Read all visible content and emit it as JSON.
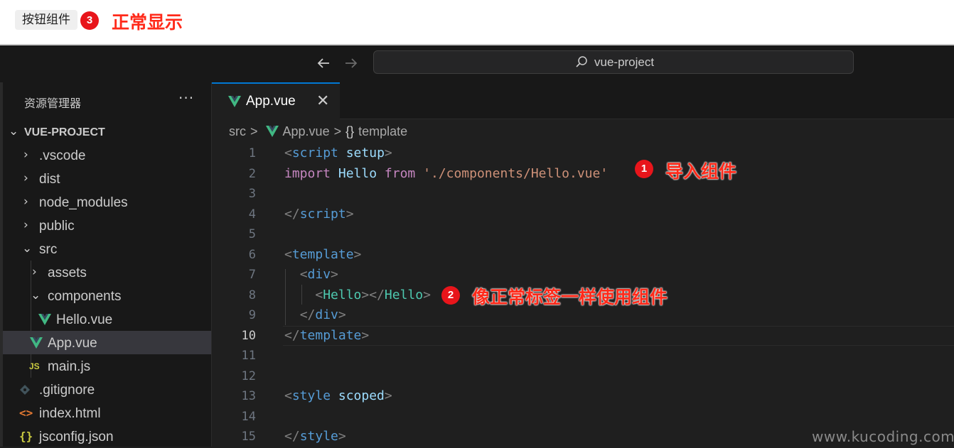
{
  "preview": {
    "button_label": "按钮组件",
    "badge_3": "3",
    "annotation_3": "正常显示"
  },
  "titlebar": {
    "back_icon": "arrow-left-icon",
    "forward_icon": "arrow-right-icon",
    "search_text": "vue-project"
  },
  "sidebar": {
    "title": "资源管理器",
    "more": "···",
    "project": "VUE-PROJECT",
    "items": [
      {
        "label": ".vscode",
        "kind": "folder",
        "state": "collapsed"
      },
      {
        "label": "dist",
        "kind": "folder",
        "state": "collapsed"
      },
      {
        "label": "node_modules",
        "kind": "folder",
        "state": "collapsed"
      },
      {
        "label": "public",
        "kind": "folder",
        "state": "collapsed"
      },
      {
        "label": "src",
        "kind": "folder",
        "state": "expanded"
      },
      {
        "label": "assets",
        "kind": "folder",
        "state": "collapsed"
      },
      {
        "label": "components",
        "kind": "folder",
        "state": "expanded"
      },
      {
        "label": "Hello.vue",
        "kind": "vue-file"
      },
      {
        "label": "App.vue",
        "kind": "vue-file",
        "selected": true
      },
      {
        "label": "main.js",
        "kind": "js-file",
        "icon_text": "JS"
      },
      {
        "label": ".gitignore",
        "kind": "git-file"
      },
      {
        "label": "index.html",
        "kind": "html-file",
        "icon_text": "<>"
      },
      {
        "label": "jsconfig.json",
        "kind": "json-file",
        "icon_text": "{}"
      }
    ]
  },
  "editor": {
    "tab_label": "App.vue",
    "tab_close": "✕",
    "breadcrumb": {
      "part1": "src",
      "part2": "App.vue",
      "part3": "template",
      "sep": ">",
      "braces": "{}"
    },
    "active_line": 10,
    "lines": [
      "1",
      "2",
      "3",
      "4",
      "5",
      "6",
      "7",
      "8",
      "9",
      "10",
      "11",
      "12",
      "13",
      "14",
      "15"
    ],
    "code": {
      "l1_open": "<",
      "l1_tag": "script",
      "l1_attr": "setup",
      "l1_close": ">",
      "l2_import": "import",
      "l2_id": "Hello",
      "l2_from": "from",
      "l2_str": "'./components/Hello.vue'",
      "l4_open": "</",
      "l4_tag": "script",
      "l4_close": ">",
      "l6_open": "<",
      "l6_tag": "template",
      "l6_close": ">",
      "l7_open": "<",
      "l7_tag": "div",
      "l7_close": ">",
      "l8_open": "<",
      "l8_tag": "Hello",
      "l8_mid": "></",
      "l8_tag2": "Hello",
      "l8_close": ">",
      "l9_open": "</",
      "l9_tag": "div",
      "l9_close": ">",
      "l10_open": "</",
      "l10_tag": "template",
      "l10_close": ">",
      "l13_open": "<",
      "l13_tag": "style",
      "l13_attr": "scoped",
      "l13_close": ">",
      "l15_open": "</",
      "l15_tag": "style",
      "l15_close": ">"
    }
  },
  "annotations": {
    "badge_1": "1",
    "text_1": "导入组件",
    "badge_2": "2",
    "text_2": "像正常标签一样使用组件"
  },
  "watermark": "www.kucoding.com",
  "colors": {
    "accent": "#0078d4",
    "annotation_red": "#e8151b",
    "vue_green": "#41b883"
  }
}
